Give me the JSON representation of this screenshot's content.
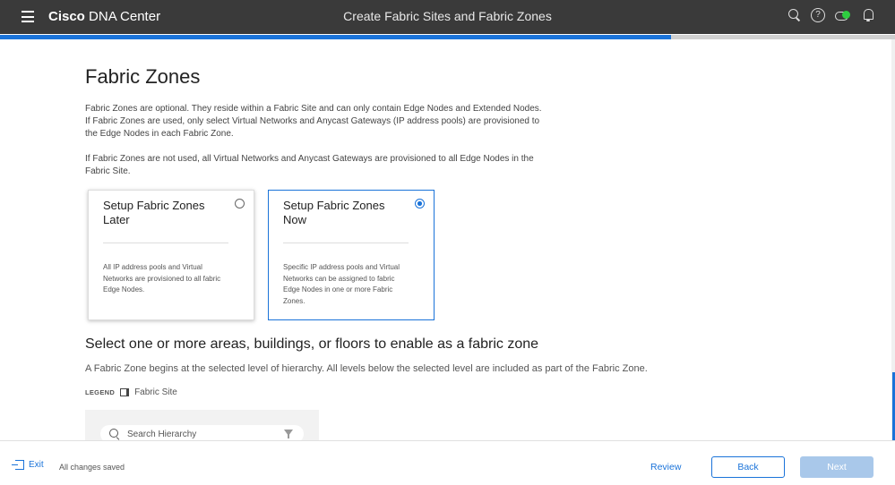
{
  "header": {
    "brand_bold": "Cisco",
    "brand_rest": "DNA Center",
    "page_title": "Create Fabric Sites and Fabric Zones",
    "icons": [
      "menu-icon",
      "search-icon",
      "help-icon",
      "cloud-status-icon",
      "bell-icon"
    ],
    "cloud_status_color": "#2ecc40"
  },
  "progress": {
    "fraction": 0.75,
    "color": "#1a73d9"
  },
  "main": {
    "title": "Fabric Zones",
    "para1": "Fabric Zones are optional. They reside within a Fabric Site and can only contain Edge Nodes and Extended Nodes. If Fabric Zones are used, only select Virtual Networks and Anycast Gateways (IP address pools) are provisioned to the Edge Nodes in each Fabric Zone.",
    "para2": "If Fabric Zones are not used, all Virtual Networks and Anycast Gateways are provisioned to all Edge Nodes in the Fabric Site.",
    "options": [
      {
        "title": "Setup Fabric Zones Later",
        "description": "All IP address pools and Virtual Networks are provisioned to all fabric Edge Nodes.",
        "selected": false
      },
      {
        "title": "Setup Fabric Zones Now",
        "description": "Specific IP address pools and Virtual Networks can be assigned to fabric Edge Nodes in one or more Fabric Zones.",
        "selected": true
      }
    ],
    "subtitle": "Select one or more areas, buildings, or floors to enable as a fabric zone",
    "description": "A Fabric Zone begins at the selected level of hierarchy. All levels below the selected level are included as part of the Fabric Zone.",
    "legend": {
      "label": "LEGEND",
      "item": "Fabric Site"
    },
    "hierarchy_search": {
      "placeholder": "Search Hierarchy",
      "value": ""
    }
  },
  "footer": {
    "exit_label": "Exit",
    "status": "All changes saved",
    "review_label": "Review",
    "back_label": "Back",
    "next_label": "Next",
    "accent_color": "#1a73d9"
  }
}
